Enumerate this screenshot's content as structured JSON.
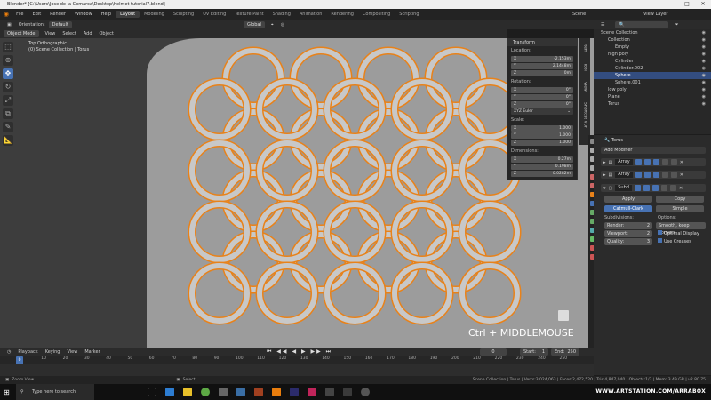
{
  "title_bar": {
    "title": "Blender* [C:\\Users\\Jose de la Comarca\\Desktop\\helmet tutorial7.blend]",
    "min": "—",
    "max": "□",
    "close": "✕"
  },
  "menu": {
    "items": [
      "File",
      "Edit",
      "Render",
      "Window",
      "Help"
    ],
    "workspaces": [
      "Layout",
      "Modeling",
      "Sculpting",
      "UV Editing",
      "Texture Paint",
      "Shading",
      "Animation",
      "Rendering",
      "Compositing",
      "Scripting"
    ],
    "active_workspace": "Layout",
    "scene": "Scene",
    "view_layer": "View Layer"
  },
  "viewport_header": {
    "orientation_label": "Orientation:",
    "orientation_value": "Default",
    "transform_orientation": "Global",
    "mode": "Object Mode",
    "menus": [
      "View",
      "Select",
      "Add",
      "Object"
    ]
  },
  "viewport": {
    "view_name": "Top Orthographic",
    "collection_info": "(0) Scene Collection | Torus",
    "hint": "Ctrl + MIDDLEMOUSE"
  },
  "n_panel": {
    "title": "Transform",
    "location_label": "Location:",
    "location": [
      "-2.153m",
      "2.1448m",
      "0m"
    ],
    "rotation_label": "Rotation:",
    "rotation": [
      "0°",
      "0°",
      "0°"
    ],
    "rotation_mode": "XYZ Euler",
    "scale_label": "Scale:",
    "scale": [
      "1.000",
      "1.000",
      "1.000"
    ],
    "dimensions_label": "Dimensions:",
    "dimensions": [
      "0.27m",
      "0.198m",
      "0.0282m"
    ],
    "axes": [
      "X",
      "Y",
      "Z"
    ],
    "tabs": [
      "Item",
      "Tool",
      "View",
      "Shortcut VUr"
    ]
  },
  "outliner": {
    "rows": [
      {
        "name": "Scene Collection",
        "indent": 0,
        "selected": false
      },
      {
        "name": "Collection",
        "indent": 1,
        "selected": false
      },
      {
        "name": "Empty",
        "indent": 2,
        "selected": false
      },
      {
        "name": "high poly",
        "indent": 1,
        "selected": false
      },
      {
        "name": "Cylinder",
        "indent": 2,
        "selected": false
      },
      {
        "name": "Cylinder.002",
        "indent": 2,
        "selected": false
      },
      {
        "name": "Sphere",
        "indent": 2,
        "selected": true
      },
      {
        "name": "Sphere.001",
        "indent": 2,
        "selected": false
      },
      {
        "name": "low poly",
        "indent": 1,
        "selected": false
      },
      {
        "name": "Plane",
        "indent": 1,
        "selected": false
      },
      {
        "name": "Torus",
        "indent": 1,
        "selected": false
      }
    ]
  },
  "properties": {
    "object_name": "Torus",
    "add_modifier": "Add Modifier",
    "modifiers": [
      "Array",
      "Array",
      "Subd"
    ],
    "apply": "Apply",
    "copy": "Copy",
    "catmull": "Catmull-Clark",
    "simple": "Simple",
    "subdivisions_label": "Subdivisions:",
    "options_label": "Options:",
    "render_label": "Render:",
    "render_val": "2",
    "viewport_label": "Viewport:",
    "viewport_val": "2",
    "quality_label": "Quality:",
    "quality_val": "3",
    "uv_option": "Smooth, keep corners",
    "optimal_display": "Optimal Display",
    "use_creases": "Use Creases"
  },
  "timeline": {
    "menus": [
      "Playback",
      "Keying",
      "View",
      "Marker"
    ],
    "current_frame": "0",
    "start_label": "Start:",
    "start": "1",
    "end_label": "End:",
    "end": "250",
    "ticks": [
      "0",
      "10",
      "20",
      "30",
      "40",
      "50",
      "60",
      "70",
      "80",
      "90",
      "100",
      "110",
      "120",
      "130",
      "140",
      "150",
      "160",
      "170",
      "180",
      "190",
      "200",
      "210",
      "220",
      "230",
      "240",
      "250"
    ]
  },
  "status_bar": {
    "left": "Zoom View",
    "middle": "Select",
    "right": "Scene Collection | Torus | Verts:3,024,063 | Faces:2,472,520 | Tris:4,847,040 | Objects:1/7 | Mem: 3.49 GB | v2.80.75"
  },
  "taskbar": {
    "search_placeholder": "Type here to search",
    "watermark": "WWW.ARTSTATION.COM/ARRABOX"
  },
  "colors": {
    "accent": "#4772b3",
    "outline": "#e8821a",
    "canvas": "#9c9c9c"
  }
}
